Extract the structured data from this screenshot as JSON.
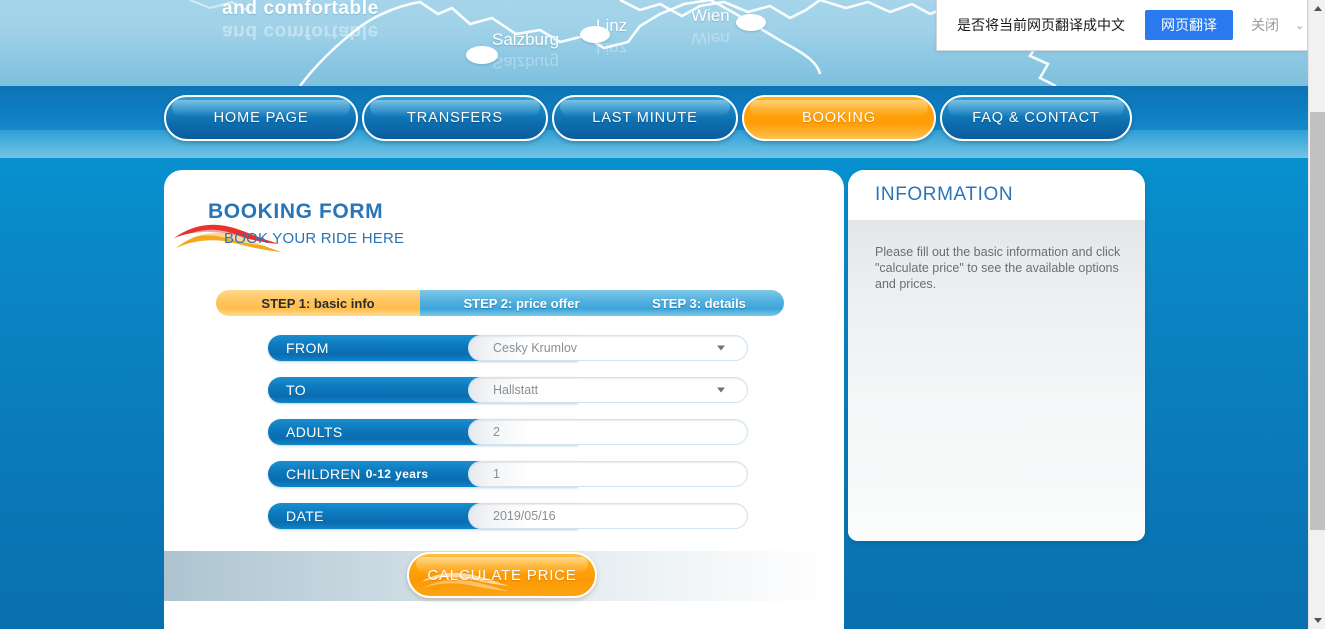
{
  "translate_bar": {
    "question": "是否将当前网页翻译成中文",
    "translate_label": "网页翻译",
    "close_label": "关闭",
    "chevron": "⌄"
  },
  "banner": {
    "tagline": "and comfortable",
    "cities": [
      {
        "name": "Salzburg"
      },
      {
        "name": "Linz"
      },
      {
        "name": "Wien"
      }
    ]
  },
  "nav": {
    "items": [
      {
        "label": "HOME PAGE",
        "active": false
      },
      {
        "label": "TRANSFERS",
        "active": false
      },
      {
        "label": "LAST MINUTE",
        "active": false
      },
      {
        "label": "BOOKING",
        "active": true
      },
      {
        "label": "FAQ & CONTACT",
        "active": false
      }
    ]
  },
  "booking_form": {
    "title": "BOOKING FORM",
    "subtitle": "BOOK YOUR RIDE HERE",
    "steps": [
      {
        "label": "STEP 1: basic info",
        "active": true
      },
      {
        "label": "STEP 2: price offer",
        "active": false
      },
      {
        "label": "STEP 3: details",
        "active": false
      }
    ],
    "fields": [
      {
        "label": "FROM",
        "sub": "",
        "value": "Cesky Krumlov",
        "type": "select"
      },
      {
        "label": "TO",
        "sub": "",
        "value": "Hallstatt",
        "type": "select"
      },
      {
        "label": "ADULTS",
        "sub": "",
        "value": "2",
        "type": "text"
      },
      {
        "label": "CHILDREN",
        "sub": "0-12 years",
        "value": "1",
        "type": "text"
      },
      {
        "label": "DATE",
        "sub": "",
        "value": "2019/05/16",
        "type": "text"
      }
    ],
    "calculate_label": "CALCULATE PRICE"
  },
  "information": {
    "title": "INFORMATION",
    "text": "Please fill out the basic information and click \"calculate price\" to see the available options and prices."
  },
  "colors": {
    "accent_blue": "#0073ba",
    "accent_orange": "#ffa80f",
    "title_blue": "#2a74b8",
    "translate_button": "#2979ef"
  }
}
